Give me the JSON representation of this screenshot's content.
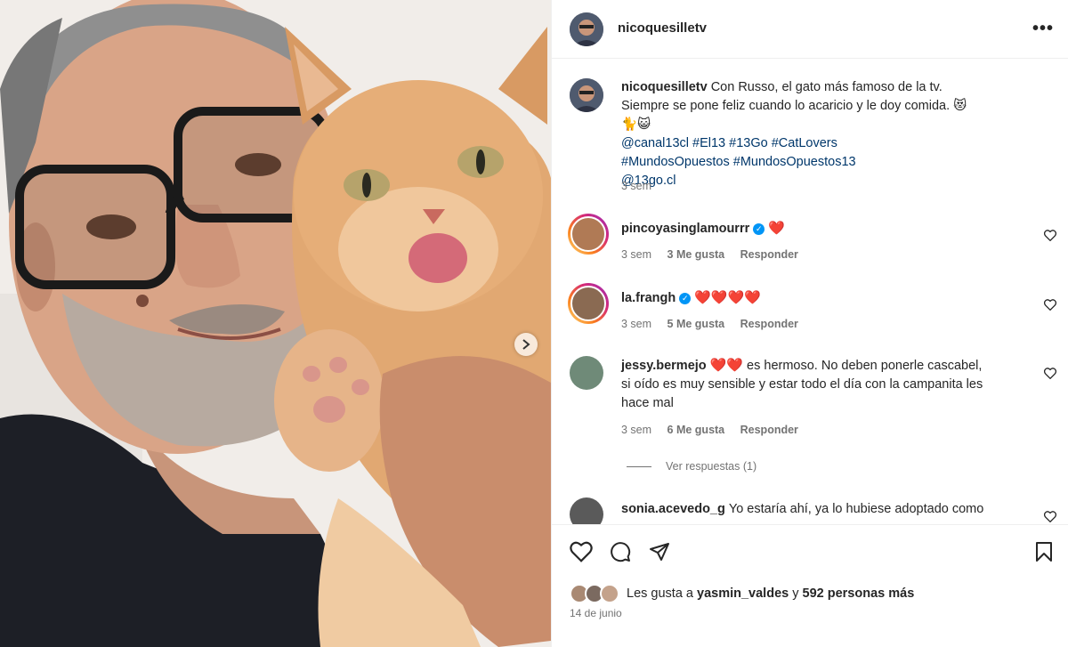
{
  "post": {
    "username": "nicoquesilletv",
    "more_icon": "more-horizontal-icon"
  },
  "caption": {
    "username": "nicoquesilletv",
    "text": "Con Russo, el gato más famoso de la tv. Siempre se pone feliz cuando lo acaricio y le doy comida. 😻🐈😺",
    "tags": [
      "@canal13cl",
      "#El13",
      "#13Go",
      "#CatLovers",
      "#MundosOpuestos",
      "#MundosOpuestos13",
      "@13go.cl"
    ],
    "time": "3 sem"
  },
  "comments": [
    {
      "username": "pincoyasinglamourrr",
      "verified": true,
      "text": "❤️",
      "time": "3 sem",
      "likes": "3 Me gusta",
      "reply": "Responder",
      "avatar_color": "#b07a55"
    },
    {
      "username": "la.frangh",
      "verified": true,
      "text": "❤️❤️❤️❤️",
      "time": "3 sem",
      "likes": "5 Me gusta",
      "reply": "Responder",
      "avatar_color": "#8a6a52"
    },
    {
      "username": "jessy.bermejo",
      "verified": false,
      "text_hearts": "❤️❤️",
      "text": "es hermoso. No deben ponerle cascabel, si oído es muy sensible y estar todo el día con la campanita les hace mal",
      "time": "3 sem",
      "likes": "6 Me gusta",
      "reply": "Responder",
      "avatar_color": "#6f8a78",
      "view_replies": "Ver respuestas (1)"
    },
    {
      "username": "sonia.acevedo_g",
      "verified": false,
      "text": "Yo estaría ahí, ya lo hubiese adoptado como",
      "avatar_color": "#5a5a5a"
    }
  ],
  "actions": {
    "like_icon": "heart-outline-icon",
    "comment_icon": "comment-icon",
    "share_icon": "send-icon",
    "save_icon": "bookmark-icon"
  },
  "likes": {
    "prefix": "Les gusta a",
    "user": "yasmin_valdes",
    "middle": "y",
    "count": "592 personas más"
  },
  "date": "14 de junio",
  "colors": {
    "link": "#00376b",
    "muted": "#737373",
    "verified": "#0095f6",
    "heart": "#ed1c40"
  }
}
